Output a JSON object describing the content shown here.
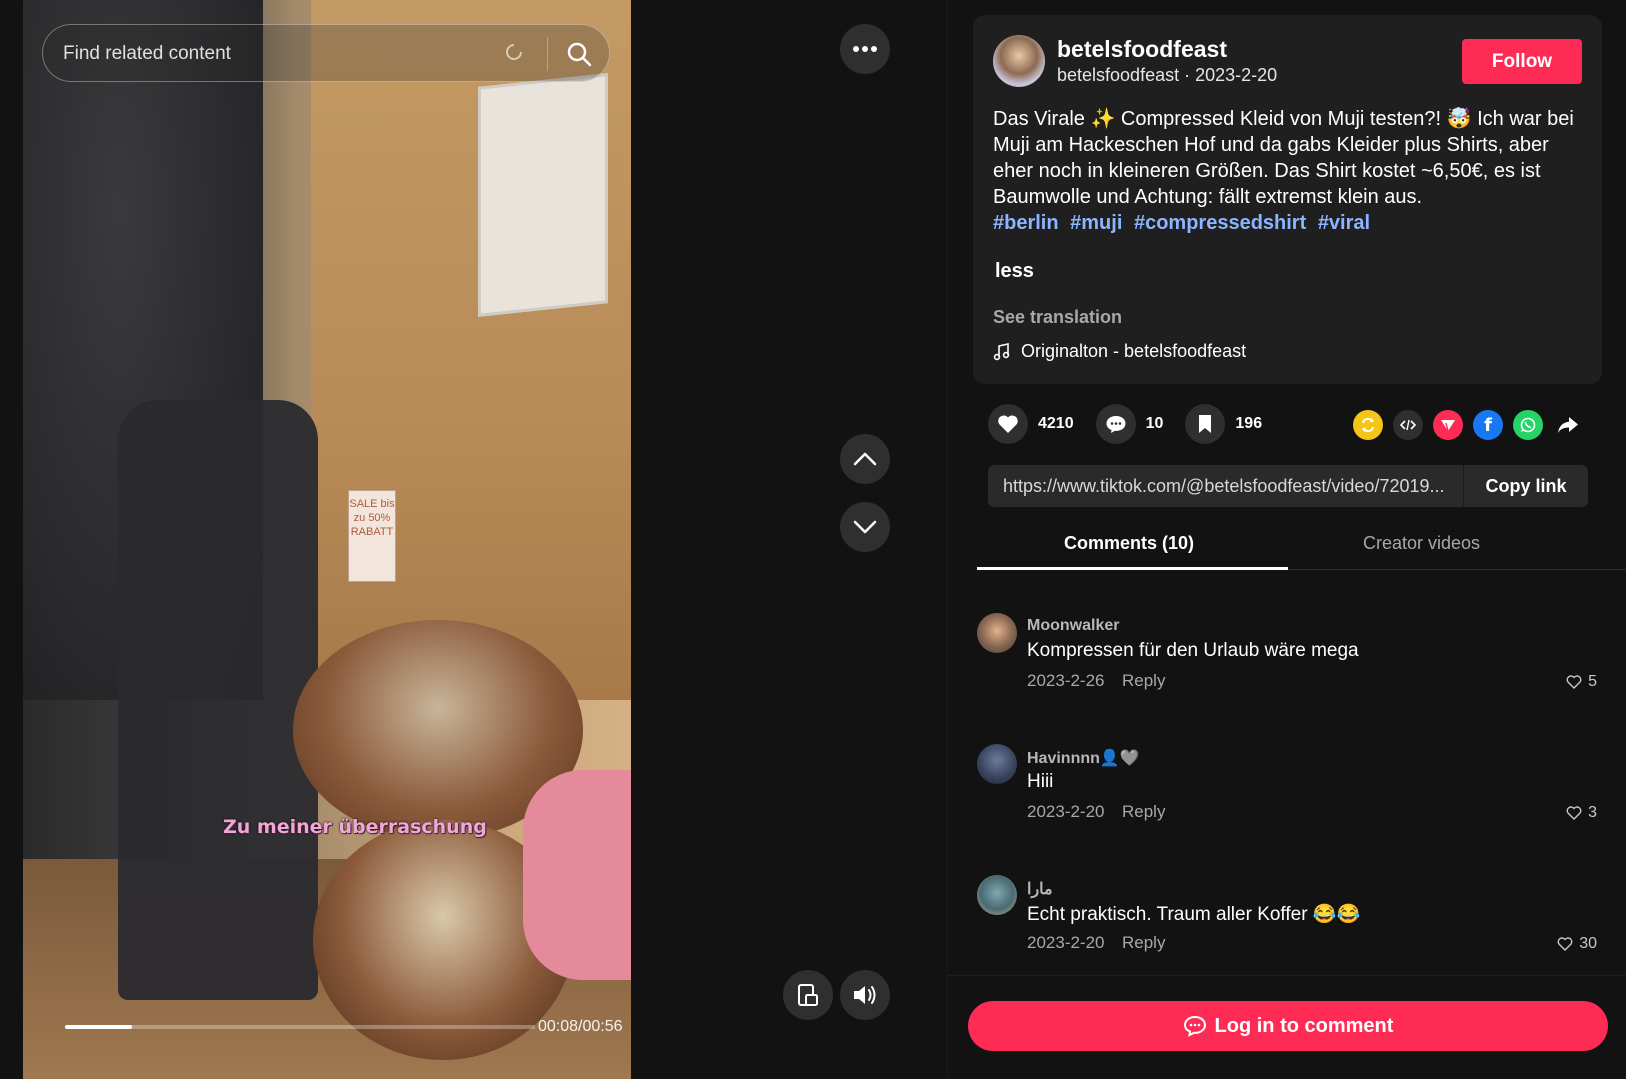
{
  "search": {
    "placeholder": "Find related content"
  },
  "video": {
    "caption_overlay": "Zu meiner überraschung",
    "current_time": "00:08",
    "duration": "00:56",
    "time_label": "00:08/00:56",
    "progress_fraction": 0.143,
    "sale_tag": "SALE bis zu 50% RABATT"
  },
  "post": {
    "username": "betelsfoodfeast",
    "handle": "betelsfoodfeast",
    "date": "2023-2-20",
    "submeta": "betelsfoodfeast · 2023-2-20",
    "follow_label": "Follow",
    "description": "Das Virale ✨ Compressed Kleid von Muji testen?! 🤯 Ich war bei Muji am Hackeschen Hof und da gabs Kleider plus Shirts, aber eher noch in kleineren Größen. Das Shirt kostet ~6,50€, es ist Baumwolle und Achtung: fällt extremst klein aus.",
    "hashtags": [
      "#berlin",
      "#muji",
      "#compressedshirt",
      "#viral"
    ],
    "less_label": "less",
    "see_translation": "See translation",
    "music": "Originalton - betelsfoodfeast"
  },
  "stats": {
    "likes": "4210",
    "comments": "10",
    "saves": "196"
  },
  "share": {
    "icons": [
      "repost-icon",
      "embed-icon",
      "send-icon",
      "facebook-icon",
      "whatsapp-icon",
      "share-arrow-icon"
    ],
    "url": "https://www.tiktok.com/@betelsfoodfeast/video/72019...",
    "copy_label": "Copy link"
  },
  "tabs": {
    "comments": "Comments (10)",
    "creator_videos": "Creator videos"
  },
  "comments": [
    {
      "name": "Moonwalker",
      "text": "Kompressen für den Urlaub wäre mega",
      "date": "2023-2-26",
      "reply": "Reply",
      "likes": "5"
    },
    {
      "name": "Havinnnn👤🩶",
      "text": "Hiii",
      "date": "2023-2-20",
      "reply": "Reply",
      "likes": "3"
    },
    {
      "name": "مارا",
      "text": "Echt praktisch. Traum aller Koffer 😂😂",
      "date": "2023-2-20",
      "reply": "Reply",
      "likes": "30"
    }
  ],
  "login": {
    "label": "Log in to comment"
  },
  "colors": {
    "accent": "#fe2c55",
    "hashtag": "#8cb4ff",
    "panel": "#1f1f1f",
    "background": "#121212"
  }
}
